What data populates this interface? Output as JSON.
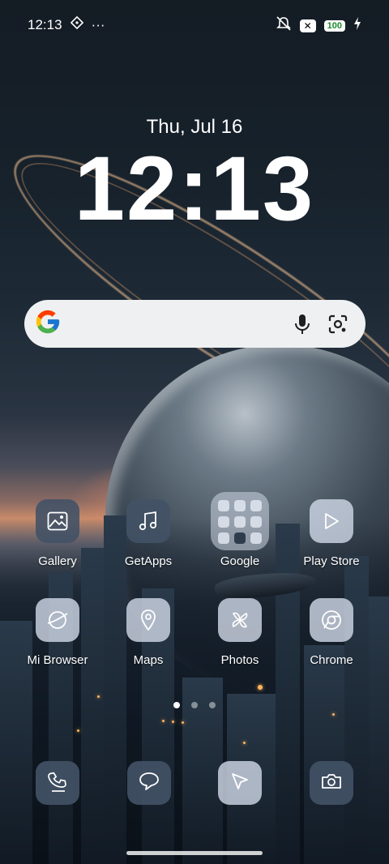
{
  "status_bar": {
    "time": "12:13",
    "overflow": "···",
    "battery": "100",
    "x_badge": "✕"
  },
  "lockclock": {
    "date": "Thu, Jul 16",
    "time": "12:13"
  },
  "search": {
    "icons": [
      "google-logo-icon",
      "microphone-icon",
      "lens-camera-icon"
    ]
  },
  "apps": [
    {
      "label": "Gallery",
      "icon": "gallery-icon"
    },
    {
      "label": "GetApps",
      "icon": "music-note-icon"
    },
    {
      "label": "Google",
      "icon": "folder-icon"
    },
    {
      "label": "Play Store",
      "icon": "play-store-icon"
    },
    {
      "label": "Mi Browser",
      "icon": "browser-icon"
    },
    {
      "label": "Maps",
      "icon": "map-pin-icon"
    },
    {
      "label": "Photos",
      "icon": "pinwheel-icon"
    },
    {
      "label": "Chrome",
      "icon": "chrome-icon"
    }
  ],
  "dock": [
    {
      "icon": "phone-icon"
    },
    {
      "icon": "message-bubble-icon"
    },
    {
      "icon": "cursor-icon"
    },
    {
      "icon": "camera-icon"
    }
  ],
  "colors": {
    "icon_dark": "#425266",
    "icon_light": "#cdd6e4",
    "battery_text": "#1b8a2e"
  }
}
